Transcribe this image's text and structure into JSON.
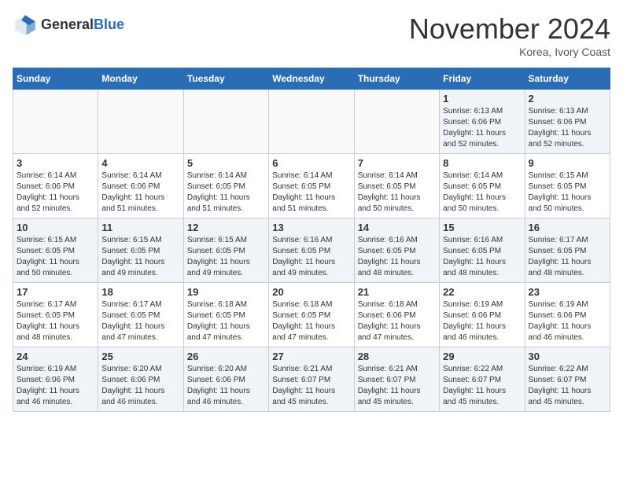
{
  "header": {
    "logo_general": "General",
    "logo_blue": "Blue",
    "month": "November 2024",
    "location": "Korea, Ivory Coast"
  },
  "weekdays": [
    "Sunday",
    "Monday",
    "Tuesday",
    "Wednesday",
    "Thursday",
    "Friday",
    "Saturday"
  ],
  "weeks": [
    [
      {
        "day": "",
        "info": ""
      },
      {
        "day": "",
        "info": ""
      },
      {
        "day": "",
        "info": ""
      },
      {
        "day": "",
        "info": ""
      },
      {
        "day": "",
        "info": ""
      },
      {
        "day": "1",
        "info": "Sunrise: 6:13 AM\nSunset: 6:06 PM\nDaylight: 11 hours\nand 52 minutes."
      },
      {
        "day": "2",
        "info": "Sunrise: 6:13 AM\nSunset: 6:06 PM\nDaylight: 11 hours\nand 52 minutes."
      }
    ],
    [
      {
        "day": "3",
        "info": "Sunrise: 6:14 AM\nSunset: 6:06 PM\nDaylight: 11 hours\nand 52 minutes."
      },
      {
        "day": "4",
        "info": "Sunrise: 6:14 AM\nSunset: 6:06 PM\nDaylight: 11 hours\nand 51 minutes."
      },
      {
        "day": "5",
        "info": "Sunrise: 6:14 AM\nSunset: 6:05 PM\nDaylight: 11 hours\nand 51 minutes."
      },
      {
        "day": "6",
        "info": "Sunrise: 6:14 AM\nSunset: 6:05 PM\nDaylight: 11 hours\nand 51 minutes."
      },
      {
        "day": "7",
        "info": "Sunrise: 6:14 AM\nSunset: 6:05 PM\nDaylight: 11 hours\nand 50 minutes."
      },
      {
        "day": "8",
        "info": "Sunrise: 6:14 AM\nSunset: 6:05 PM\nDaylight: 11 hours\nand 50 minutes."
      },
      {
        "day": "9",
        "info": "Sunrise: 6:15 AM\nSunset: 6:05 PM\nDaylight: 11 hours\nand 50 minutes."
      }
    ],
    [
      {
        "day": "10",
        "info": "Sunrise: 6:15 AM\nSunset: 6:05 PM\nDaylight: 11 hours\nand 50 minutes."
      },
      {
        "day": "11",
        "info": "Sunrise: 6:15 AM\nSunset: 6:05 PM\nDaylight: 11 hours\nand 49 minutes."
      },
      {
        "day": "12",
        "info": "Sunrise: 6:15 AM\nSunset: 6:05 PM\nDaylight: 11 hours\nand 49 minutes."
      },
      {
        "day": "13",
        "info": "Sunrise: 6:16 AM\nSunset: 6:05 PM\nDaylight: 11 hours\nand 49 minutes."
      },
      {
        "day": "14",
        "info": "Sunrise: 6:16 AM\nSunset: 6:05 PM\nDaylight: 11 hours\nand 48 minutes."
      },
      {
        "day": "15",
        "info": "Sunrise: 6:16 AM\nSunset: 6:05 PM\nDaylight: 11 hours\nand 48 minutes."
      },
      {
        "day": "16",
        "info": "Sunrise: 6:17 AM\nSunset: 6:05 PM\nDaylight: 11 hours\nand 48 minutes."
      }
    ],
    [
      {
        "day": "17",
        "info": "Sunrise: 6:17 AM\nSunset: 6:05 PM\nDaylight: 11 hours\nand 48 minutes."
      },
      {
        "day": "18",
        "info": "Sunrise: 6:17 AM\nSunset: 6:05 PM\nDaylight: 11 hours\nand 47 minutes."
      },
      {
        "day": "19",
        "info": "Sunrise: 6:18 AM\nSunset: 6:05 PM\nDaylight: 11 hours\nand 47 minutes."
      },
      {
        "day": "20",
        "info": "Sunrise: 6:18 AM\nSunset: 6:05 PM\nDaylight: 11 hours\nand 47 minutes."
      },
      {
        "day": "21",
        "info": "Sunrise: 6:18 AM\nSunset: 6:06 PM\nDaylight: 11 hours\nand 47 minutes."
      },
      {
        "day": "22",
        "info": "Sunrise: 6:19 AM\nSunset: 6:06 PM\nDaylight: 11 hours\nand 46 minutes."
      },
      {
        "day": "23",
        "info": "Sunrise: 6:19 AM\nSunset: 6:06 PM\nDaylight: 11 hours\nand 46 minutes."
      }
    ],
    [
      {
        "day": "24",
        "info": "Sunrise: 6:19 AM\nSunset: 6:06 PM\nDaylight: 11 hours\nand 46 minutes."
      },
      {
        "day": "25",
        "info": "Sunrise: 6:20 AM\nSunset: 6:06 PM\nDaylight: 11 hours\nand 46 minutes."
      },
      {
        "day": "26",
        "info": "Sunrise: 6:20 AM\nSunset: 6:06 PM\nDaylight: 11 hours\nand 46 minutes."
      },
      {
        "day": "27",
        "info": "Sunrise: 6:21 AM\nSunset: 6:07 PM\nDaylight: 11 hours\nand 45 minutes."
      },
      {
        "day": "28",
        "info": "Sunrise: 6:21 AM\nSunset: 6:07 PM\nDaylight: 11 hours\nand 45 minutes."
      },
      {
        "day": "29",
        "info": "Sunrise: 6:22 AM\nSunset: 6:07 PM\nDaylight: 11 hours\nand 45 minutes."
      },
      {
        "day": "30",
        "info": "Sunrise: 6:22 AM\nSunset: 6:07 PM\nDaylight: 11 hours\nand 45 minutes."
      }
    ]
  ]
}
